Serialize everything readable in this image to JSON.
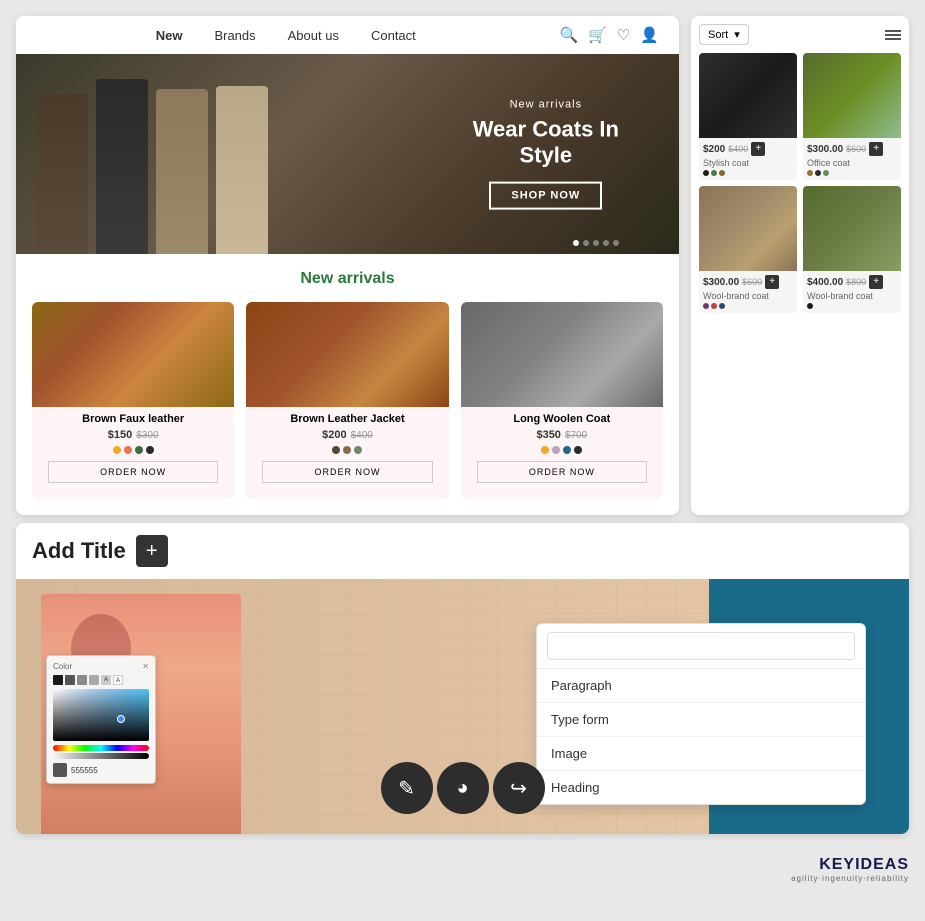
{
  "nav": {
    "links": [
      "New",
      "Brands",
      "About us",
      "Contact"
    ],
    "active": "New"
  },
  "hero": {
    "subtitle": "New arrivals",
    "title": "Wear Coats In\nStyle",
    "cta_label": "SHOP NOW"
  },
  "new_arrivals": {
    "section_title_highlight": "New",
    "section_title_rest": " arrivals",
    "products": [
      {
        "name": "Brown Faux leather",
        "price_current": "$150",
        "price_original": "$300",
        "colors": [
          "#f5a623",
          "#e8734a",
          "#3d6b3d",
          "#2a2a2a"
        ],
        "order_label": "ORDER NOW",
        "img_class": "img-brown-faux"
      },
      {
        "name": "Brown Leather Jacket",
        "price_current": "$200",
        "price_original": "$400",
        "colors": [
          "#4a4a3a",
          "#8a6a4a",
          "#6a8a6a"
        ],
        "order_label": "ORDER NOW",
        "img_class": "img-brown-jacket"
      },
      {
        "name": "Long Woolen Coat",
        "price_current": "$350",
        "price_original": "$700",
        "colors": [
          "#f5a623",
          "#c0a0c0",
          "#1a6a8a",
          "#2a2a2a"
        ],
        "order_label": "ORDER NOW",
        "img_class": "img-long-woolen"
      }
    ]
  },
  "right_panel": {
    "sort_label": "Sort",
    "products": [
      {
        "name": "Stylish coat",
        "price_current": "$200",
        "price_original": "$400",
        "colors": [
          "#1a1a1a",
          "#4a7a4a",
          "#8a6a2a"
        ],
        "add_label": "+",
        "img_class": "img-stylish-coat"
      },
      {
        "name": "Office coat",
        "price_current": "$300.00",
        "price_original": "$600",
        "colors": [
          "#8a7a2a",
          "#2a2a2a",
          "#6a8a5a"
        ],
        "add_label": "+",
        "img_class": "img-office-coat"
      },
      {
        "name": "Wool-brand coat",
        "price_current": "$300.00",
        "price_original": "$600",
        "colors": [
          "#6a3a6a",
          "#c04040",
          "#2a4a6a"
        ],
        "add_label": "+",
        "img_class": "img-wool-plaid"
      },
      {
        "name": "Wool-brand coat",
        "price_current": "$400.00",
        "price_original": "$800",
        "colors": [
          "#1a1a1a"
        ],
        "add_label": "+",
        "img_class": "img-wool-olive"
      }
    ]
  },
  "bottom": {
    "add_title_label": "Add Title",
    "add_plus_label": "+",
    "dropdown_items": [
      "Paragraph",
      "Type form",
      "Image",
      "Heading"
    ],
    "color_picker": {
      "label": "Color",
      "hex_value": "555555"
    }
  },
  "toolbar": {
    "edit_icon": "✎",
    "user_icon": "◕",
    "redo_icon": "↪"
  },
  "footer": {
    "logo": "KEYIDEAS",
    "tagline": "agility·ingenuity·reliability"
  }
}
